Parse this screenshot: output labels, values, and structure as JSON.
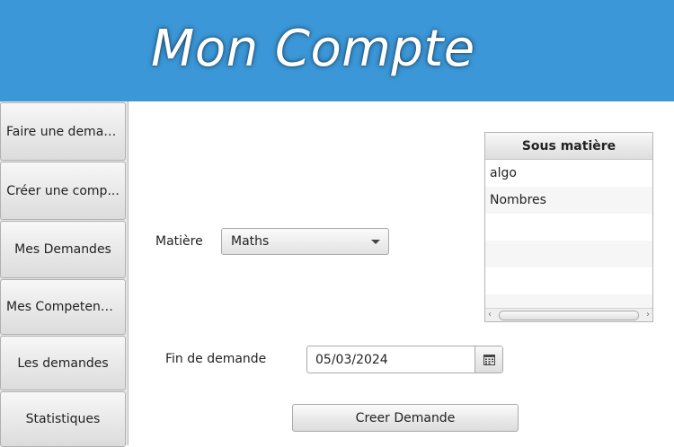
{
  "header": {
    "title": "Mon Compte"
  },
  "sidebar": {
    "items": [
      {
        "label": "Faire une deman..."
      },
      {
        "label": "Créer une comp..."
      },
      {
        "label": "Mes Demandes"
      },
      {
        "label": "Mes Competences"
      },
      {
        "label": "Les demandes"
      },
      {
        "label": "Statistiques"
      }
    ]
  },
  "form": {
    "matiere_label": "Matière",
    "matiere_value": "Maths",
    "fin_label": "Fin de demande",
    "fin_value": "05/03/2024",
    "submit_label": "Creer Demande"
  },
  "table": {
    "header": "Sous matière",
    "rows": [
      "algo",
      "Nombres",
      "",
      "",
      "",
      ""
    ]
  },
  "colors": {
    "header_bg": "#3b97d8",
    "title_text": "#ffffff"
  },
  "icons": {
    "date_picker": "calendar-icon",
    "combo": "chevron-down-icon"
  }
}
